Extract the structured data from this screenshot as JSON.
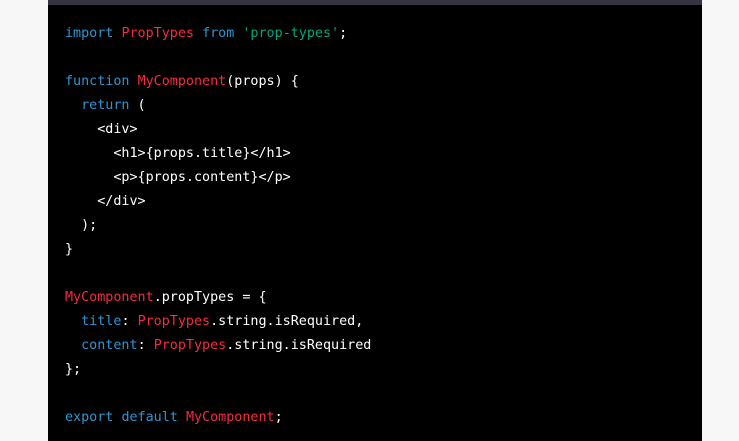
{
  "colors": {
    "page_background": "#f7f7f8",
    "code_background": "#000000",
    "header_bar": "#343541",
    "keyword": "#2e95d3",
    "class_name": "#f22c3d",
    "string": "#00a67d",
    "plain": "#ffffff"
  },
  "code": {
    "language": "javascript",
    "lines": [
      [
        {
          "t": "kw",
          "v": "import"
        },
        {
          "t": "plain",
          "v": " "
        },
        {
          "t": "cls",
          "v": "PropTypes"
        },
        {
          "t": "plain",
          "v": " "
        },
        {
          "t": "kw",
          "v": "from"
        },
        {
          "t": "plain",
          "v": " "
        },
        {
          "t": "str",
          "v": "'prop-types'"
        },
        {
          "t": "plain",
          "v": ";"
        }
      ],
      [],
      [
        {
          "t": "kw",
          "v": "function"
        },
        {
          "t": "plain",
          "v": " "
        },
        {
          "t": "cls",
          "v": "MyComponent"
        },
        {
          "t": "plain",
          "v": "(props) {"
        }
      ],
      [
        {
          "t": "plain",
          "v": "  "
        },
        {
          "t": "kw",
          "v": "return"
        },
        {
          "t": "plain",
          "v": " ("
        }
      ],
      [
        {
          "t": "plain",
          "v": "    <div>"
        }
      ],
      [
        {
          "t": "plain",
          "v": "      <h1>{props.title}</h1>"
        }
      ],
      [
        {
          "t": "plain",
          "v": "      <p>{props.content}</p>"
        }
      ],
      [
        {
          "t": "plain",
          "v": "    </div>"
        }
      ],
      [
        {
          "t": "plain",
          "v": "  );"
        }
      ],
      [
        {
          "t": "plain",
          "v": "}"
        }
      ],
      [],
      [
        {
          "t": "cls",
          "v": "MyComponent"
        },
        {
          "t": "plain",
          "v": ".propTypes = {"
        }
      ],
      [
        {
          "t": "plain",
          "v": "  "
        },
        {
          "t": "kw",
          "v": "title"
        },
        {
          "t": "plain",
          "v": ": "
        },
        {
          "t": "cls",
          "v": "PropTypes"
        },
        {
          "t": "plain",
          "v": ".string.isRequired,"
        }
      ],
      [
        {
          "t": "plain",
          "v": "  "
        },
        {
          "t": "kw",
          "v": "content"
        },
        {
          "t": "plain",
          "v": ": "
        },
        {
          "t": "cls",
          "v": "PropTypes"
        },
        {
          "t": "plain",
          "v": ".string.isRequired"
        }
      ],
      [
        {
          "t": "plain",
          "v": "};"
        }
      ],
      [],
      [
        {
          "t": "kw",
          "v": "export"
        },
        {
          "t": "plain",
          "v": " "
        },
        {
          "t": "kw",
          "v": "default"
        },
        {
          "t": "plain",
          "v": " "
        },
        {
          "t": "cls",
          "v": "MyComponent"
        },
        {
          "t": "plain",
          "v": ";"
        }
      ]
    ]
  }
}
